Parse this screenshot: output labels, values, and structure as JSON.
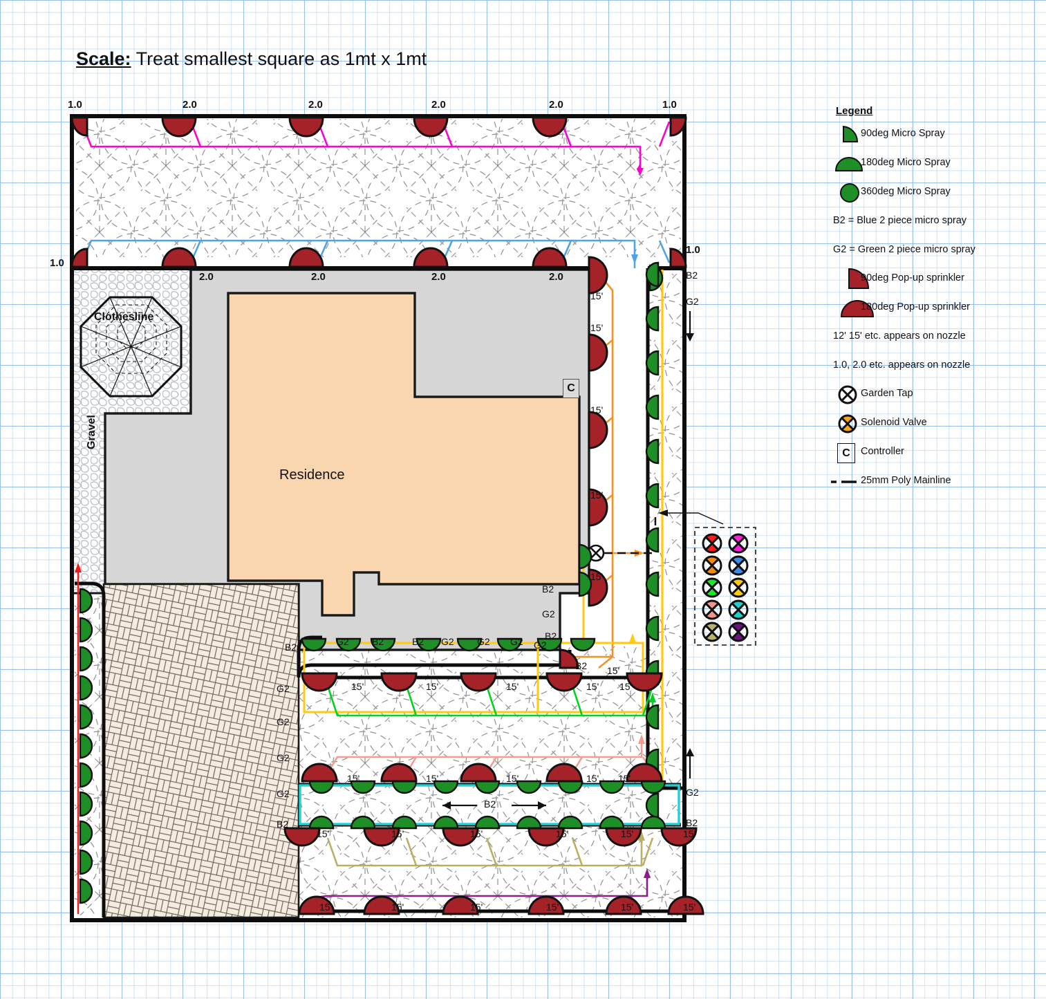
{
  "title": {
    "bold": "Scale:",
    "rest": " Treat smallest square as 1mt x 1mt"
  },
  "legend": {
    "heading": "Legend",
    "items": [
      {
        "icon": "micro-spray-90-icon",
        "label": "90deg Micro Spray"
      },
      {
        "icon": "micro-spray-180-icon",
        "label": "180deg Micro Spray"
      },
      {
        "icon": "micro-spray-360-icon",
        "label": "360deg Micro Spray"
      },
      {
        "icon": "none",
        "label": "B2 = Blue 2 piece micro spray"
      },
      {
        "icon": "none",
        "label": "G2 = Green 2 piece micro spray"
      },
      {
        "icon": "popup-90-icon",
        "label": "90deg Pop-up sprinkler"
      },
      {
        "icon": "popup-180-icon",
        "label": "180deg Pop-up sprinkler"
      },
      {
        "icon": "none",
        "label": "12'  15'  etc. appears on nozzle"
      },
      {
        "icon": "none",
        "label": "1.0, 2.0 etc. appears on nozzle"
      },
      {
        "icon": "garden-tap-icon",
        "label": "Garden Tap"
      },
      {
        "icon": "solenoid-valve-icon",
        "label": "Solenoid Valve"
      },
      {
        "icon": "controller-icon",
        "label": "Controller"
      },
      {
        "icon": "mainline-icon",
        "label": "25mm Poly Mainline"
      }
    ]
  },
  "plan": {
    "residence_label": "Residence",
    "clothesline_label": "Clothesline",
    "gravel_label": "Gravel",
    "controller_label": "C"
  },
  "nozzles": {
    "top_row": [
      "1.0",
      "2.0",
      "2.0",
      "2.0",
      "2.0",
      "1.0"
    ],
    "second_row_left": "1.0",
    "second_row": [
      "2.0",
      "2.0",
      "2.0",
      "2.0"
    ],
    "second_row_right": "1.0",
    "fifteen": "15'"
  },
  "zone_labels": {
    "b2": "B2",
    "g2": "G2",
    "right_top_b2": "B2",
    "right_top_g2": "G2",
    "right_mid_g2": "G2",
    "right_mid_b2": "B2"
  },
  "colors": {
    "pipe_magenta": "#ff00d0",
    "pipe_blue": "#4da3e8",
    "pipe_orange": "#f59322",
    "pipe_yellow": "#ffc90e",
    "pipe_green": "#00d21e",
    "pipe_salmon": "#f79b8e",
    "pipe_cyan": "#1fd0d6",
    "pipe_khaki": "#b9ae62",
    "pipe_purple": "#8d1a8d",
    "pipe_red": "#f01a1a",
    "sprinkler_red": "#a52229",
    "micro_green": "#1e8f26",
    "house_fill": "#fad6b0",
    "paving_fill": "#d6d6d6",
    "paver_fill": "#f4ece1",
    "gravel_fill": "#ffffff"
  },
  "manifold": {
    "left_column": [
      "#ff1e1e",
      "#f58a18",
      "#1fe52b",
      "#f2968c",
      "#b9b073"
    ],
    "right_column": [
      "#ff1edc",
      "#3b8ce8",
      "#ffc90e",
      "#1fd0c8",
      "#6b1380"
    ]
  }
}
